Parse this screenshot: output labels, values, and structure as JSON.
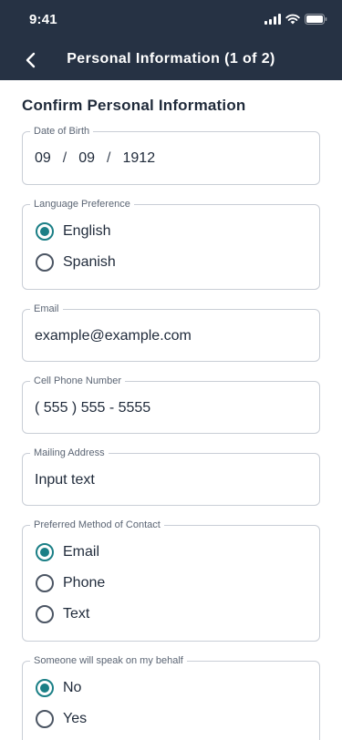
{
  "status_bar": {
    "time": "9:41",
    "icons": [
      "signal-icon",
      "wifi-icon",
      "battery-icon"
    ]
  },
  "nav": {
    "title": "Personal Information (1 of 2)",
    "back_icon": "chevron-left-icon"
  },
  "section_title": "Confirm Personal Information",
  "dob": {
    "label": "Date of Birth",
    "month": "09",
    "day": "09",
    "year": "1912",
    "separator": "/"
  },
  "language": {
    "label": "Language Preference",
    "options": [
      {
        "label": "English",
        "selected": true
      },
      {
        "label": "Spanish",
        "selected": false
      }
    ]
  },
  "email": {
    "label": "Email",
    "value": "example@example.com"
  },
  "phone": {
    "label": "Cell Phone Number",
    "value": "( 555 ) 555 - 5555"
  },
  "address": {
    "label": "Mailing Address",
    "value": "Input text"
  },
  "contact": {
    "label": "Preferred Method of Contact",
    "options": [
      {
        "label": "Email",
        "selected": true
      },
      {
        "label": "Phone",
        "selected": false
      },
      {
        "label": "Text",
        "selected": false
      }
    ]
  },
  "behalf": {
    "label": "Someone will speak on my behalf",
    "options": [
      {
        "label": "No",
        "selected": true
      },
      {
        "label": "Yes",
        "selected": false
      }
    ]
  },
  "colors": {
    "header_bg": "#263244",
    "accent": "#1b7f86",
    "border": "#c9ced6"
  }
}
